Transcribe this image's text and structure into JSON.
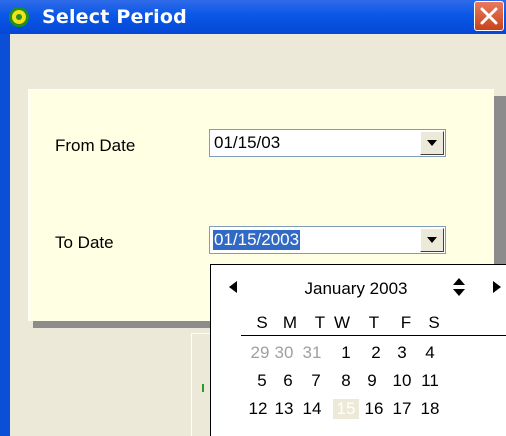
{
  "window": {
    "title": "Select Period",
    "colors": {
      "titlebar": "#0a57e6",
      "close": "#d2542b",
      "panel": "#ffffe4"
    }
  },
  "form": {
    "from_label": "From Date",
    "from_value": "01/15/03",
    "to_label": "To Date",
    "to_value": "01/15/2003"
  },
  "calendar": {
    "month_label": "January 2003",
    "weekdays": [
      "S",
      "M",
      "T",
      "W",
      "T",
      "F",
      "S"
    ],
    "rows": [
      [
        "29",
        "30",
        "31",
        "1",
        "2",
        "3",
        "4"
      ],
      [
        "5",
        "6",
        "7",
        "8",
        "9",
        "10",
        "11"
      ],
      [
        "12",
        "13",
        "14",
        "15",
        "16",
        "17",
        "18"
      ]
    ],
    "today": "15"
  },
  "icons": [
    "app-icon",
    "close-icon",
    "chevron-down-icon",
    "arrow-left-icon",
    "arrow-right-icon",
    "up-down-icon"
  ]
}
